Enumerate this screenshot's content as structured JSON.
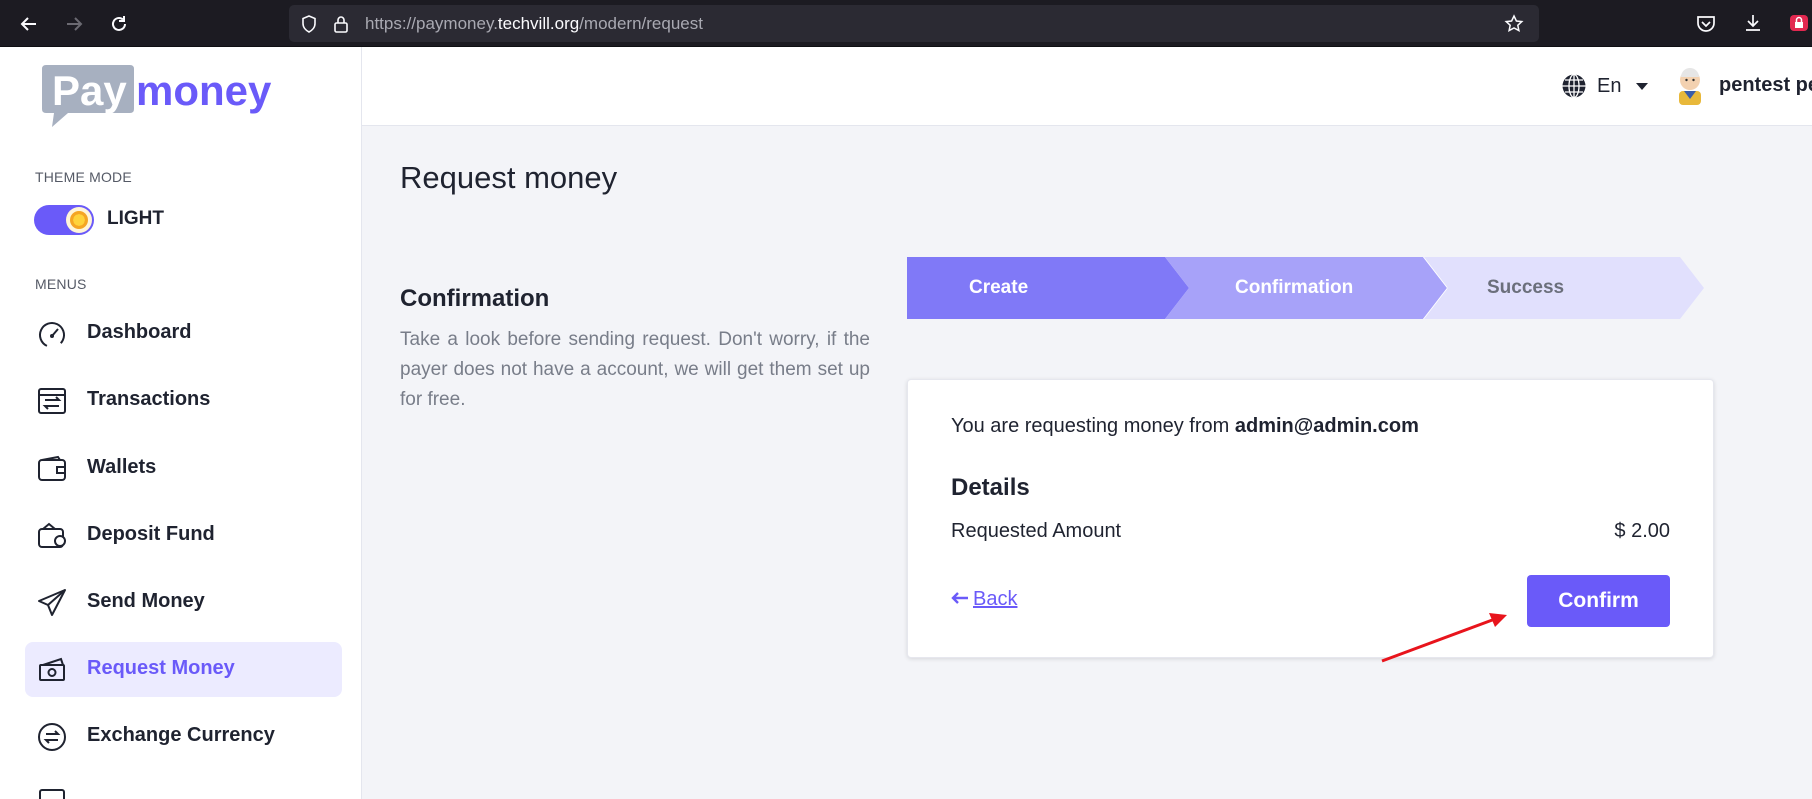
{
  "browser": {
    "url_prefix": "https://paymoney.",
    "url_host": "techvill.org",
    "url_path": "/modern/request"
  },
  "sidebar": {
    "logo_text": "Paymoney",
    "theme_mode_label": "THEME MODE",
    "theme_toggle_label": "LIGHT",
    "menus_label": "MENUS",
    "items": [
      {
        "label": "Dashboard",
        "icon": "dashboard-gauge-icon"
      },
      {
        "label": "Transactions",
        "icon": "transactions-icon"
      },
      {
        "label": "Wallets",
        "icon": "wallet-icon"
      },
      {
        "label": "Deposit Fund",
        "icon": "deposit-wallet-icon"
      },
      {
        "label": "Send Money",
        "icon": "paper-plane-icon"
      },
      {
        "label": "Request Money",
        "icon": "money-bills-icon",
        "active": true
      },
      {
        "label": "Exchange Currency",
        "icon": "exchange-icon"
      }
    ]
  },
  "header": {
    "language": "En",
    "user_name": "pentest pe"
  },
  "main": {
    "page_title": "Request money",
    "section_title": "Confirmation",
    "section_description": "Take a look before sending request. Don't worry, if the payer does not have a account, we will get them set up for free.",
    "steps": [
      {
        "label": "Create",
        "state": "done"
      },
      {
        "label": "Confirmation",
        "state": "current"
      },
      {
        "label": "Success",
        "state": "pending"
      }
    ],
    "card": {
      "request_text": "You are requesting money from",
      "request_email": "admin@admin.com",
      "details_title": "Details",
      "amount_label": "Requested Amount",
      "amount_value": "$ 2.00",
      "back_label": "Back",
      "confirm_label": "Confirm"
    }
  },
  "colors": {
    "accent": "#6a5af9",
    "step_done": "#8079f7",
    "step_current": "#a7a2f9",
    "step_pending": "#e1e0fd",
    "annotation": "#e8141c"
  }
}
